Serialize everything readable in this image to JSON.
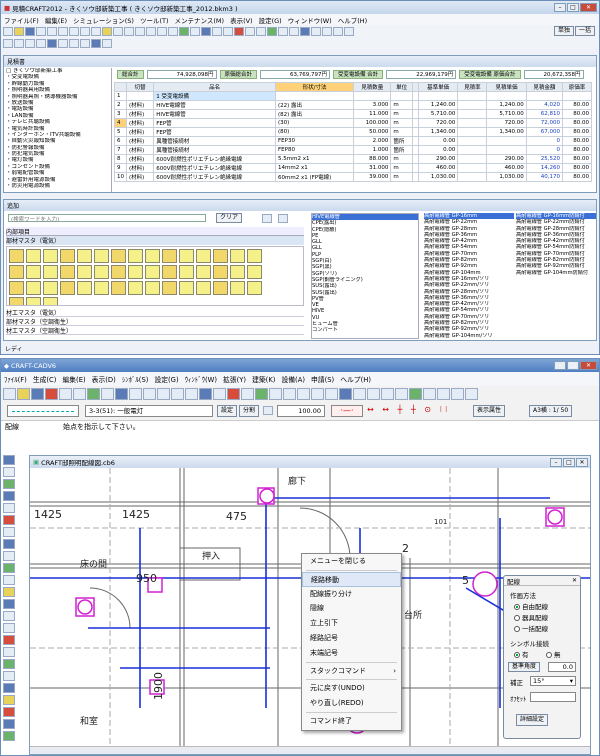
{
  "top": {
    "title": "見積CRAFT2012 - きくソウ邸新築工事 ( きくソウ邸新築工事_2012.bkm3 )",
    "menu": [
      "ファイル(F)",
      "編集(E)",
      "シミュレーション(S)",
      "ツール(T)",
      "メンテナンス(M)",
      "表示(V)",
      "設定(G)",
      "ウィンドウ(W)",
      "ヘルプ(H)"
    ],
    "mode_buttons": [
      "単独",
      "一括"
    ],
    "estimate_panel": "見積書",
    "tree": [
      "□ きくソウ邸新築工事",
      "・受変電設備",
      "・幹線動力設備",
      "・照明器具用設備",
      "・照明器具照・誘導機器設備",
      "・放送設備",
      "・電話設備",
      "・LAN設備",
      "・テレビ共聴設備",
      "・電気時計設備",
      "・インターホン・ITV共聴設備",
      "・自動火災報知設備",
      "・防犯警報設備",
      "・防犯電気設備",
      "・電灯設備",
      "・コンセント設備",
      "・弱電配管設備",
      "・避雷針用電源設備",
      "・防災用電源設備",
      "・放送室"
    ],
    "summary": [
      {
        "label": "総合計",
        "value": "74,928,098円"
      },
      {
        "label": "原価総合計",
        "value": "63,769,797円"
      },
      {
        "label": "受変電設備 合計",
        "value": "22,969,179円"
      },
      {
        "label": "受変電設備 原価合計",
        "value": "20,672,358円"
      }
    ],
    "columns": [
      "",
      "切替",
      "品名",
      "形状/寸法",
      "見積数量",
      "単位",
      "",
      "基準単価",
      "見積率",
      "見積単価",
      "見積金額",
      "原価率"
    ],
    "rows": [
      [
        "1",
        "",
        "1 受変電設備",
        "",
        "",
        "",
        "",
        "",
        "",
        "",
        "",
        ""
      ],
      [
        "2",
        "(材料)",
        "HIVE電線管",
        "(22) 露出",
        "3.000",
        "m",
        "",
        "1,240.00",
        "",
        "1,240.00",
        "4,020",
        "80.00"
      ],
      [
        "3",
        "(材料)",
        "HIVE電線管",
        "(82) 露出",
        "11.000",
        "m",
        "",
        "5,710.00",
        "",
        "5,710.00",
        "62,810",
        "80.00"
      ],
      [
        "4",
        "(材料)",
        "FEP管",
        "(30)",
        "100.000",
        "m",
        "",
        "720.00",
        "",
        "720.00",
        "72,000",
        "80.00"
      ],
      [
        "5",
        "(材料)",
        "FEP管",
        "(80)",
        "50.000",
        "m",
        "",
        "1,340.00",
        "",
        "1,340.00",
        "67,000",
        "80.00"
      ],
      [
        "6",
        "(材料)",
        "異種管接続材",
        "FEP30",
        "2.000",
        "箇所",
        "",
        "0.00",
        "",
        "",
        "0",
        "80.00"
      ],
      [
        "7",
        "(材料)",
        "異種管接続材",
        "FEP80",
        "1.000",
        "箇所",
        "",
        "0.00",
        "",
        "",
        "0",
        "80.00"
      ],
      [
        "8",
        "(材料)",
        "600V耐燃性ポリエチレン絶縁電線",
        "5.5mm2 x1",
        "88.000",
        "m",
        "",
        "290.00",
        "",
        "290.00",
        "25,520",
        "80.00"
      ],
      [
        "9",
        "(材料)",
        "600V耐燃性ポリエチレン絶縁電線",
        "14mm2 x1",
        "31.000",
        "m",
        "",
        "460.00",
        "",
        "460.00",
        "14,260",
        "80.00"
      ],
      [
        "10",
        "(材料)",
        "600V耐燃性ポリエチレン絶縁電線",
        "60mm2 x1 (FP電線)",
        "39.000",
        "m",
        "",
        "1,030.00",
        "",
        "1,030.00",
        "40,170",
        "80.00"
      ]
    ],
    "search_panel": "追加",
    "search_placeholder": "(検索ワードを入力)",
    "clear": "クリア",
    "cat1": "内部項目",
    "cat2": "部材マスタ（電気）",
    "cat_list": [
      "材工マスタ（電気）",
      "部材マスタ（空調衛生）",
      "材工マスタ（空調衛生）"
    ],
    "list_mid": [
      "HIVE電線管",
      "CPE(露出)",
      "CPE(隠蔽)",
      "PE",
      "GLL",
      "GLL",
      "PLP",
      "SGP(白)",
      "SGP(黒)",
      "SGP(ソリ)",
      "SGP(鋼管ライニング)",
      "SUS(露出)",
      "SUS(露出)",
      "PV管",
      "VE",
      "HIVE",
      "VU",
      "ヒューム管",
      "コンパート"
    ],
    "list_r1": [
      "高耐電線管 GP-16mm",
      "高耐電線管 GP-22mm",
      "高耐電線管 GP-28mm",
      "高耐電線管 GP-36mm",
      "高耐電線管 GP-42mm",
      "高耐電線管 GP-54mm",
      "高耐電線管 GP-70mm",
      "高耐電線管 GP-82mm",
      "高耐電線管 GP-92mm",
      "高耐電線管 GP-104mm",
      "高耐電線管 GP-16mm/ソリ",
      "高耐電線管 GP-22mm/ソリ",
      "高耐電線管 GP-28mm/ソリ",
      "高耐電線管 GP-36mm/ソリ",
      "高耐電線管 GP-42mm/ソリ",
      "高耐電線管 GP-54mm/ソリ",
      "高耐電線管 GP-70mm/ソリ",
      "高耐電線管 GP-82mm/ソリ",
      "高耐電線管 GP-92mm/ソリ",
      "高耐電線管 GP-104mm/ソリ"
    ],
    "list_r2": [
      "高耐電線管 GP-16mm防錆付",
      "高耐電線管 GP-22mm防錆付",
      "高耐電線管 GP-28mm防錆付",
      "高耐電線管 GP-36mm防錆付",
      "高耐電線管 GP-42mm防錆付",
      "高耐電線管 GP-54mm防錆付",
      "高耐電線管 GP-70mm防錆付",
      "高耐電線管 GP-82mm防錆付",
      "高耐電線管 GP-92mm防錆付",
      "高耐電線管 GP-104mm防錆付"
    ],
    "status": "レディ"
  },
  "cad": {
    "title": "CRAFT-CADV6",
    "menu": [
      "ﾌｧｲﾙ(F)",
      "生成(C)",
      "編集(E)",
      "表示(D)",
      "ｼﾝﾎﾞﾙ(S)",
      "設定(G)",
      "ｳｨﾝﾄﾞｳ(W)",
      "拡張(Y)",
      "建築(K)",
      "設備(A)",
      "申請(S)",
      "ヘルプ(H)"
    ],
    "layer_select": "3-3(51): 一般電灯",
    "btn_settings": "設定",
    "btn_split": "分割",
    "scale_value": "100.00",
    "btn_display": "表示属性",
    "paper": "A3横 : 1/ 50",
    "mode": "配線",
    "prompt": "始点を指示して下さい。",
    "doc_title": "CRAFT邸照明配線図.cb6",
    "labels": {
      "l1425a": "1425",
      "l1425b": "1425",
      "l475": "475",
      "l950": "950",
      "l1900": "1900",
      "l2": "2",
      "l5": "5",
      "l101": "101",
      "toko": "床の間",
      "oshi": "押入",
      "kitchen": "台所",
      "washitsu": "和室",
      "roka": "廊下"
    },
    "ctx": [
      "メニューを閉じる",
      "経路移動",
      "配線振り分け",
      "隠線",
      "立上引下",
      "経路記号",
      "末端記号",
      "スタックコマンド",
      "元に戻す(UNDO)",
      "やり直し(REDO)",
      "コマンド終了"
    ],
    "dlg": {
      "title": "配線",
      "method": "作画方法",
      "free": "自由配線",
      "fixture": "器具配線",
      "batch": "一括配線",
      "sym": "シンボル接続",
      "yes": "有",
      "no": "無",
      "angle": "基準角度",
      "angle_val": "0.0",
      "corr": "補正",
      "corr_val": "15°",
      "offset": "ｵﾌｾｯﾄ",
      "off_val": "",
      "detail": "詳細設定"
    }
  }
}
